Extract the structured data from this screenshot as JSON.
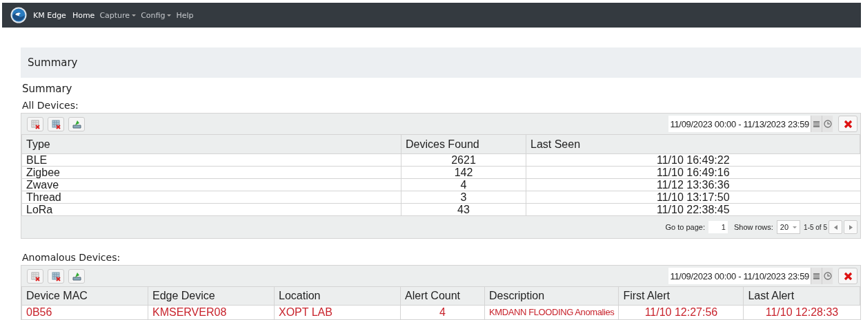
{
  "navbar": {
    "brand": "KM Edge",
    "items": [
      {
        "label": "Home",
        "selected": true,
        "dropdown": false
      },
      {
        "label": "Capture",
        "selected": false,
        "dropdown": true
      },
      {
        "label": "Config",
        "selected": false,
        "dropdown": true
      },
      {
        "label": "Help",
        "selected": false,
        "dropdown": false
      }
    ]
  },
  "page_header": "Summary",
  "heading": "Summary",
  "grids": [
    {
      "title": "All Devices:",
      "date_range": "11/09/2023 00:00 - 11/13/2023 23:59",
      "columns": [
        "Type",
        "Devices Found",
        "Last Seen"
      ],
      "rows": [
        [
          "BLE",
          "2621",
          "11/10 16:49:22"
        ],
        [
          "Zigbee",
          "142",
          "11/10 16:49:16"
        ],
        [
          "Zwave",
          "4",
          "11/12 13:36:36"
        ],
        [
          "Thread",
          "3",
          "11/10 13:17:50"
        ],
        [
          "LoRa",
          "43",
          "11/10 22:38:45"
        ]
      ],
      "alert": false,
      "pager": {
        "goto_label": "Go to page:",
        "page": "1",
        "rows_label": "Show rows:",
        "rows": "20",
        "range": "1-5 of 5"
      }
    },
    {
      "title": "Anomalous Devices:",
      "date_range": "11/09/2023 00:00 - 11/10/2023 23:59",
      "columns": [
        "Device MAC",
        "Edge Device",
        "Location",
        "Alert Count",
        "Description",
        "First Alert",
        "Last Alert"
      ],
      "rows": [
        [
          "0B56",
          "KMSERVER08",
          "XOPT LAB",
          "4",
          "KMDANN FLOODING Anomalies",
          "11/10 12:27:56",
          "11/10 12:28:33"
        ]
      ],
      "alert": true
    }
  ]
}
